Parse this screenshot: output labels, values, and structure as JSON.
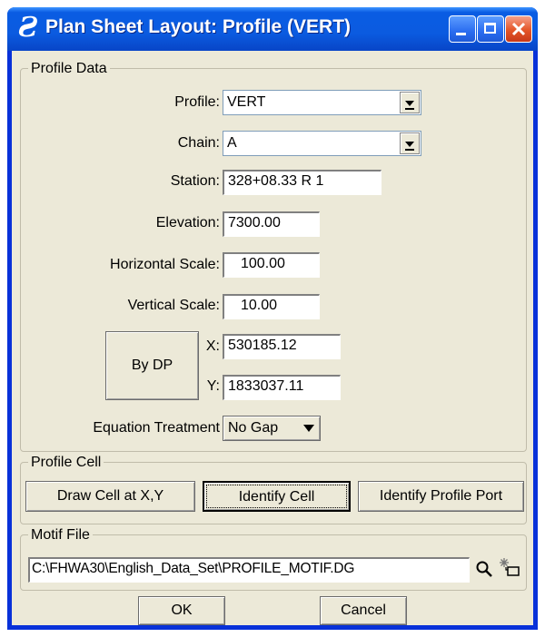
{
  "window": {
    "title": "Plan Sheet Layout: Profile (VERT)",
    "app_icon": "microstation-logo-icon",
    "logo_glyph": "Ƨ"
  },
  "profile_data": {
    "legend": "Profile Data",
    "profile_label": "Profile:",
    "profile_value": "VERT",
    "chain_label": "Chain:",
    "chain_value": "A",
    "station_label": "Station:",
    "station_value": "328+08.33 R 1",
    "elevation_label": "Elevation:",
    "elevation_value": "7300.00",
    "horizontal_scale_label": "Horizontal Scale:",
    "horizontal_scale_value": "100.00",
    "vertical_scale_label": "Vertical Scale:",
    "vertical_scale_value": "10.00",
    "by_dp_button": "By DP",
    "x_label": "X:",
    "x_value": "530185.12",
    "y_label": "Y:",
    "y_value": "1833037.11",
    "equation_treatment_label": "Equation Treatment",
    "equation_treatment_value": "No Gap"
  },
  "profile_cell": {
    "legend": "Profile Cell",
    "draw_cell_button": "Draw Cell at X,Y",
    "identify_cell_button": "Identify Cell",
    "identify_profile_port_button": "Identify Profile Port"
  },
  "motif_file": {
    "legend": "Motif File",
    "path_value": "C:\\FHWA30\\English_Data_Set\\PROFILE_MOTIF.DG",
    "icons": [
      "magnifier-icon",
      "select-file-icon"
    ]
  },
  "footer": {
    "ok_button": "OK",
    "cancel_button": "Cancel"
  }
}
